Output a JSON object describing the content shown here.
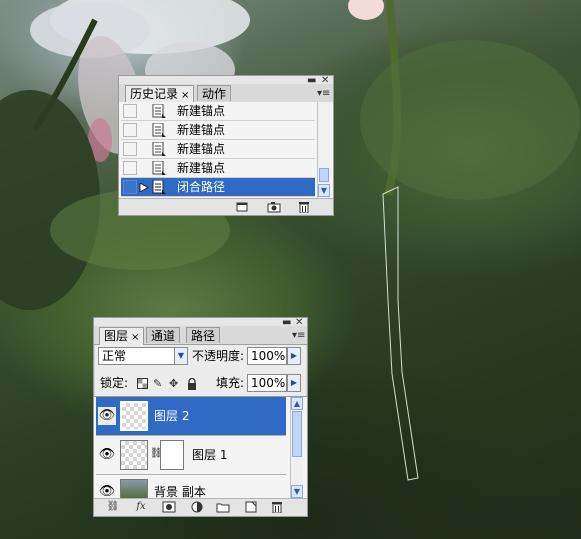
{
  "history_panel": {
    "tabs": [
      {
        "label": "历史记录",
        "close": "×"
      },
      {
        "label": "动作"
      }
    ],
    "window_controls": {
      "minimize": "▬",
      "close": "✕",
      "menu": "▾≡"
    },
    "items": [
      {
        "label": "新建锚点"
      },
      {
        "label": "新建锚点"
      },
      {
        "label": "新建锚点"
      },
      {
        "label": "新建锚点"
      },
      {
        "label": "闭合路径",
        "selected": true
      }
    ],
    "footer_icons": [
      "new-document-from-state-icon",
      "new-snapshot-icon",
      "delete-state-icon"
    ]
  },
  "layers_panel": {
    "tabs": [
      {
        "label": "图层",
        "close": "×"
      },
      {
        "label": "通道"
      },
      {
        "label": "路径"
      }
    ],
    "window_controls": {
      "minimize": "▬",
      "close": "✕",
      "menu": "▾≡"
    },
    "blend_mode": "正常",
    "opacity_label": "不透明度:",
    "opacity_value": "100%",
    "lock_label": "锁定:",
    "lock_icons": [
      "lock-transparent-icon",
      "lock-image-icon",
      "lock-position-icon",
      "lock-all-icon"
    ],
    "fill_label": "填充:",
    "fill_value": "100%",
    "layers": [
      {
        "name": "图层 2",
        "visible": true,
        "selected": true
      },
      {
        "name": "图层 1",
        "visible": true,
        "has_mask": true
      },
      {
        "name": "背景 副本",
        "visible": true
      }
    ],
    "footer_icons": [
      "link-layers-icon",
      "layer-style-icon",
      "add-mask-icon",
      "adjustment-layer-icon",
      "new-group-icon",
      "new-layer-icon",
      "delete-layer-icon"
    ]
  },
  "colors": {
    "selection": "#316ac5",
    "panel": "#ececec"
  }
}
